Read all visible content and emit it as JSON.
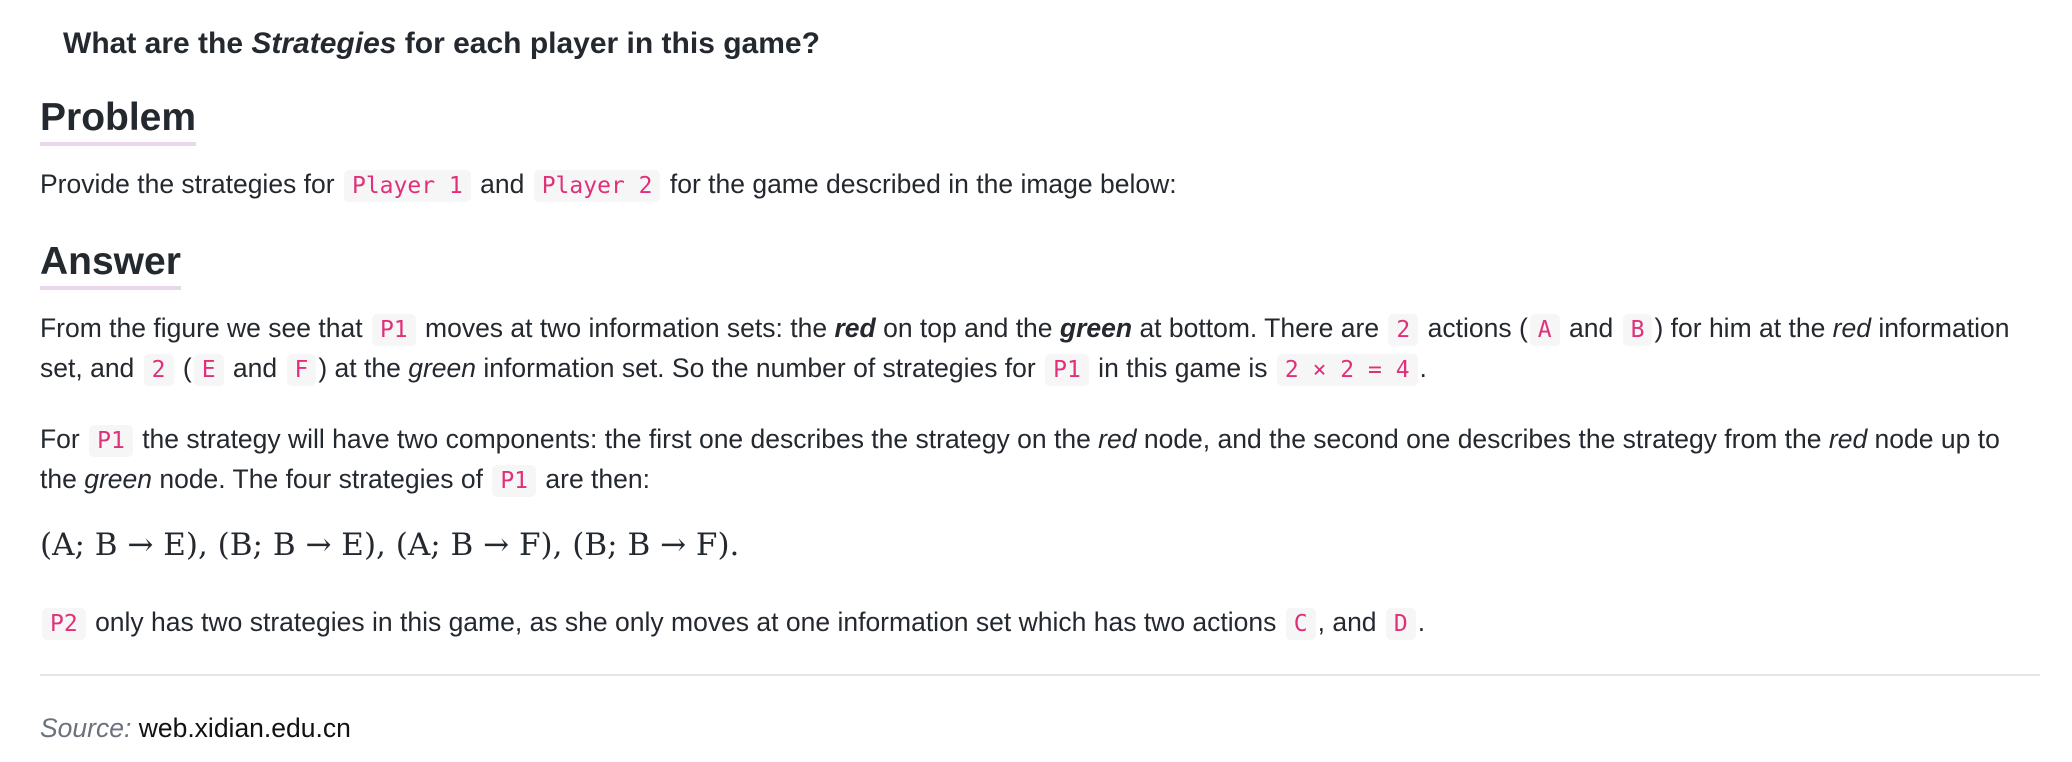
{
  "question": {
    "prefix": "What are the ",
    "emphasis": "Strategies",
    "suffix": " for each player in this game?"
  },
  "problem": {
    "heading": "Problem",
    "text_before": "Provide the strategies for ",
    "code1": "Player 1",
    "text_mid": " and ",
    "code2": "Player 2",
    "text_after": " for the game described in the image below:"
  },
  "answer": {
    "heading": "Answer",
    "p1": {
      "t1": "From the figure we see that ",
      "c1": "P1",
      "t2": " moves at two information sets: the ",
      "red": "red",
      "t3": " on top and the ",
      "green": "green",
      "t4": " at bottom. There are ",
      "c2": "2",
      "t5": " actions (",
      "c3": "A",
      "t6": " and ",
      "c4": "B",
      "t7": ") for him at the ",
      "red2": "red",
      "t8": " information",
      "t9": "set, and ",
      "c5": "2",
      "t10": " (",
      "c6": "E",
      "t11": " and ",
      "c7": "F",
      "t12": ") at the ",
      "green2": "green",
      "t13": " information set. So the number of strategies for ",
      "c8": "P1",
      "t14": " in this game is ",
      "c9": "2 × 2 = 4",
      "t15": "."
    },
    "p2": {
      "t1": "For ",
      "c1": "P1",
      "t2": " the strategy will have two components: the first one describes the strategy on the ",
      "red": "red",
      "t3": " node, and the second one describes the strategy from the ",
      "red2": "red",
      "t4": " node up to",
      "t5": "the ",
      "green": "green",
      "t6": " node. The four strategies of ",
      "c2": "P1",
      "t7": " are then:"
    },
    "formula": "(A; B → E), (B; B → E), (A; B → F), (B; B → F).",
    "p3": {
      "c1": "P2",
      "t1": " only has two strategies in this game, as she only moves at one information set which has two actions ",
      "c2": "C",
      "t2": ", and ",
      "c3": "D",
      "t3": "."
    }
  },
  "source": {
    "label": "Source:",
    "value": "web.xidian.edu.cn"
  }
}
